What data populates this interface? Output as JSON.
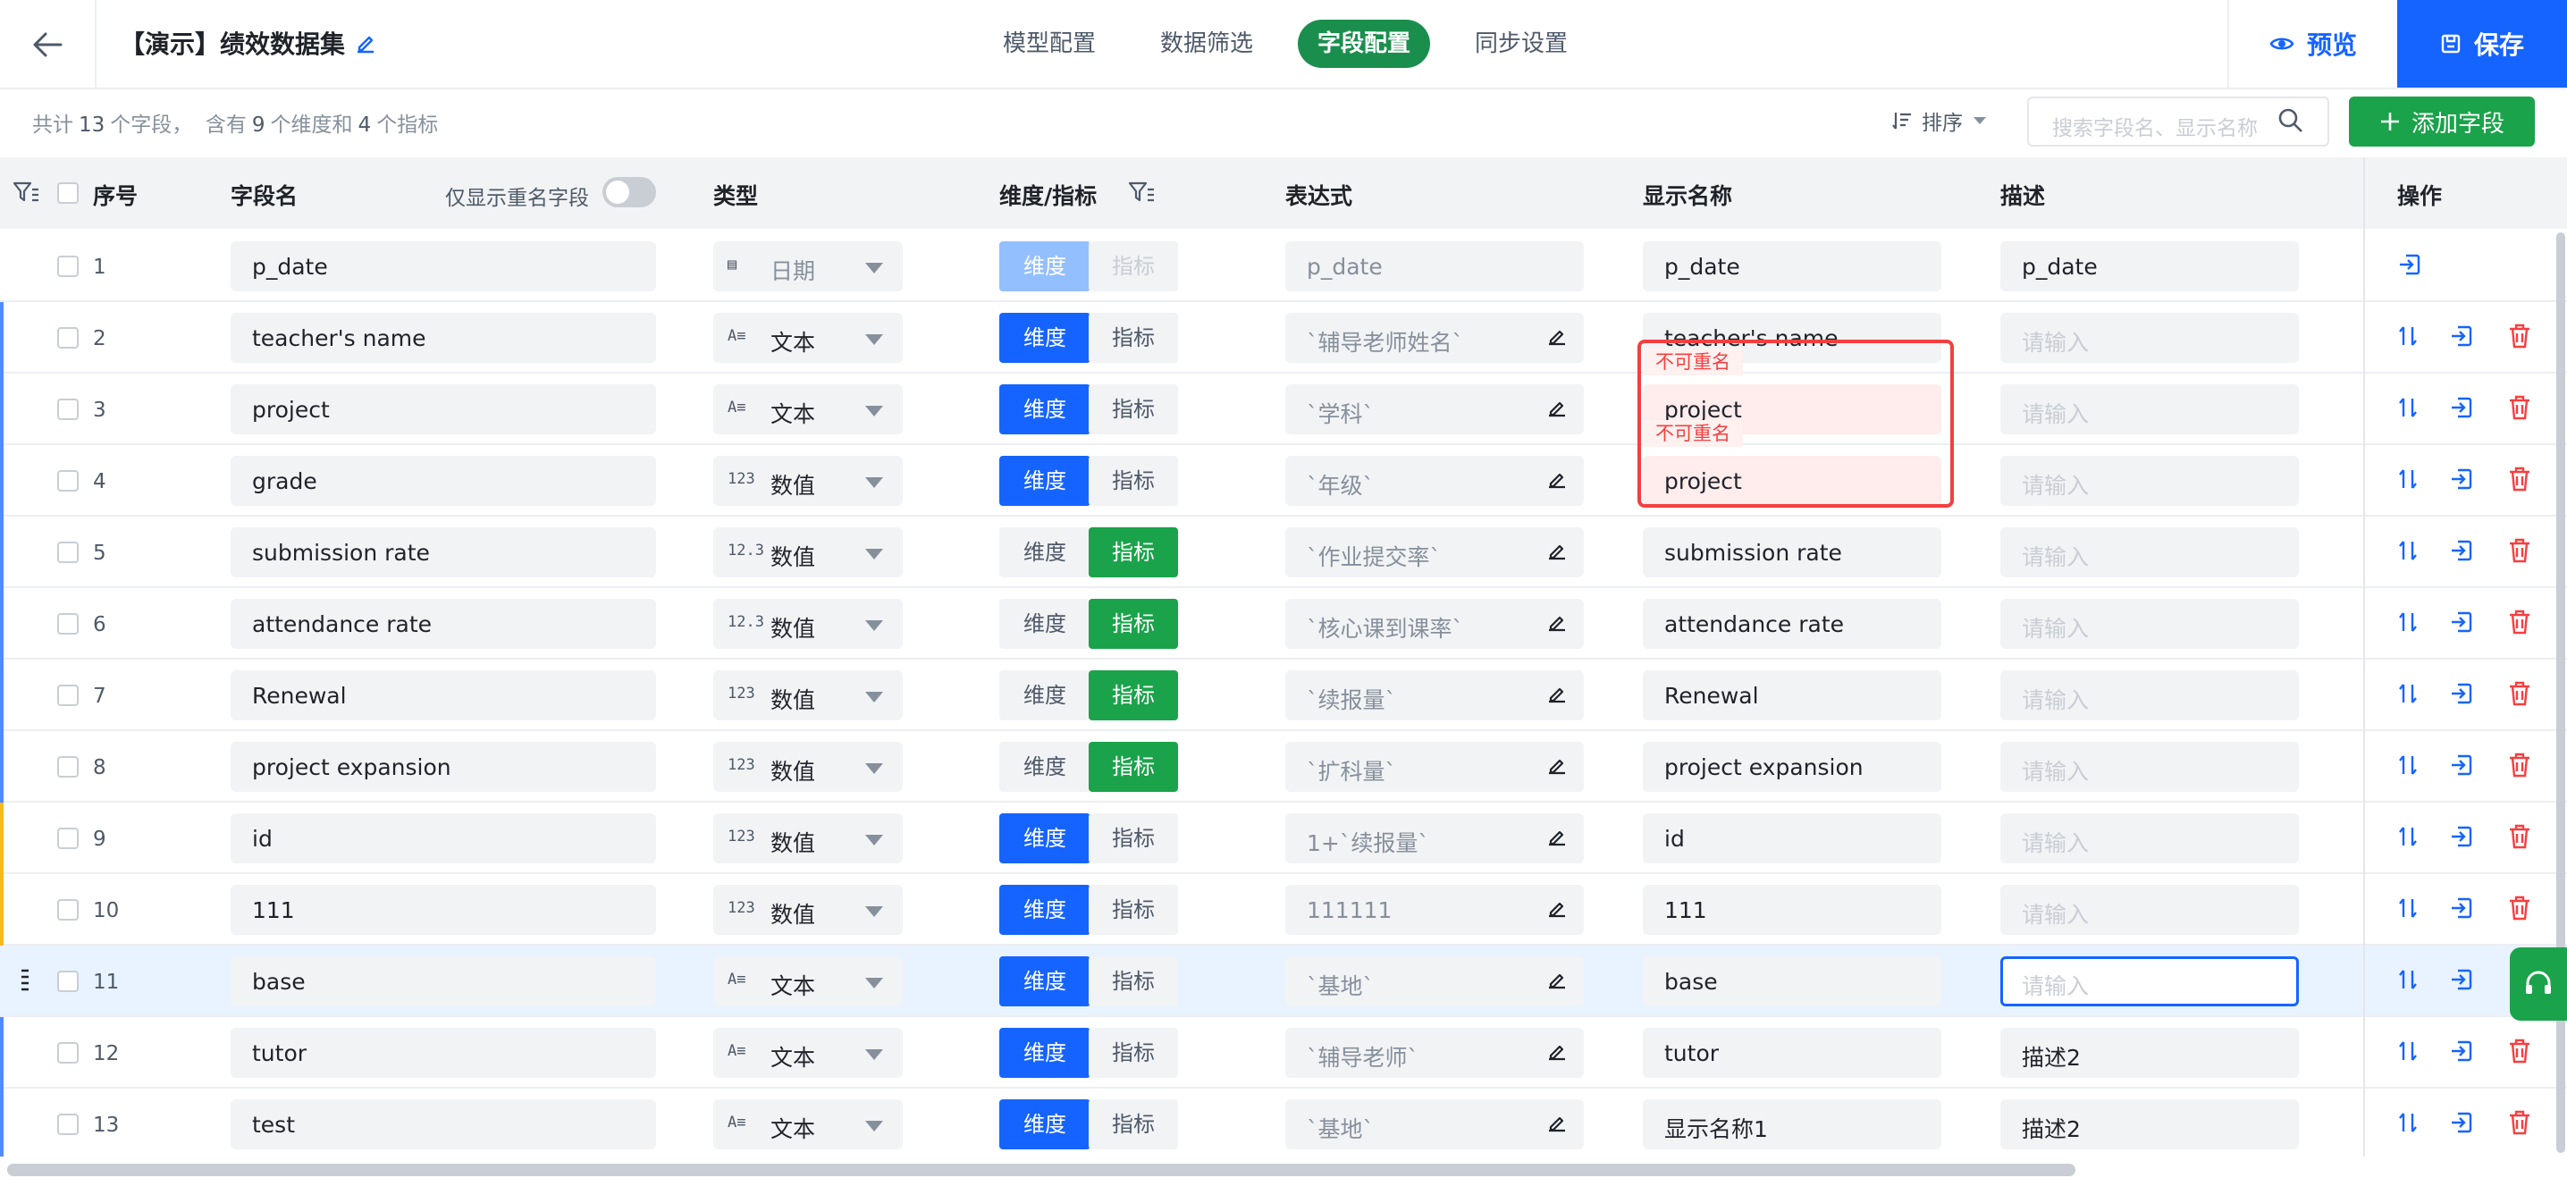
{
  "header": {
    "title": "【演示】绩效数据集",
    "tabs": [
      {
        "label": "模型配置",
        "active": false
      },
      {
        "label": "数据筛选",
        "active": false
      },
      {
        "label": "字段配置",
        "active": true
      },
      {
        "label": "同步设置",
        "active": false
      }
    ],
    "preview_label": "预览",
    "save_label": "保存"
  },
  "toolbar": {
    "summary_prefix": "共计",
    "total_fields": "13",
    "summary_mid1": "个字段，",
    "summary_mid2": "含有",
    "dimension_count": "9",
    "summary_mid3": "个维度和",
    "metric_count": "4",
    "summary_suffix": "个指标",
    "sort_label": "排序",
    "search_placeholder": "搜索字段名、显示名称",
    "add_field_label": "添加字段"
  },
  "columns": {
    "index": "序号",
    "field_name": "字段名",
    "only_duplicates": "仅显示重名字段",
    "type": "类型",
    "dim_metric": "维度/指标",
    "expression": "表达式",
    "display_name": "显示名称",
    "description": "描述",
    "actions": "操作"
  },
  "labels": {
    "dimension": "维度",
    "metric": "指标",
    "duplicate_error": "不可重名"
  },
  "colors": {
    "primary": "#1664ff",
    "green": "#1aa34a",
    "error": "#f53f3f",
    "blue_bar": "#4e8cff",
    "yellow_bar": "#f7ba1e"
  },
  "rows": [
    {
      "index": "1",
      "name": "p_date",
      "type_icon": "▤",
      "type": "日期",
      "role": "dimension",
      "expression": "p_date",
      "display": "p_date",
      "description": "p_date"
    },
    {
      "index": "2",
      "name": "teacher's name",
      "type_icon": "A≡",
      "type": "文本",
      "role": "dimension",
      "expression": "`辅导老师姓名`",
      "display": "teacher's name",
      "description": "请输入"
    },
    {
      "index": "3",
      "name": "project",
      "type_icon": "A≡",
      "type": "文本",
      "role": "dimension",
      "expression": "`学科`",
      "display": "project",
      "description": "请输入"
    },
    {
      "index": "4",
      "name": "grade",
      "type_icon": "123",
      "type": "数值",
      "role": "dimension",
      "expression": "`年级`",
      "display": "project",
      "description": "请输入"
    },
    {
      "index": "5",
      "name": "submission rate",
      "type_icon": "12.3",
      "type": "数值",
      "role": "metric",
      "expression": "`作业提交率`",
      "display": "submission rate",
      "description": "请输入"
    },
    {
      "index": "6",
      "name": "attendance rate",
      "type_icon": "12.3",
      "type": "数值",
      "role": "metric",
      "expression": "`核心课到课率`",
      "display": "attendance rate",
      "description": "请输入"
    },
    {
      "index": "7",
      "name": "Renewal",
      "type_icon": "123",
      "type": "数值",
      "role": "metric",
      "expression": "`续报量`",
      "display": "Renewal",
      "description": "请输入"
    },
    {
      "index": "8",
      "name": "project expansion",
      "type_icon": "123",
      "type": "数值",
      "role": "metric",
      "expression": "`扩科量`",
      "display": "project expansion",
      "description": "请输入"
    },
    {
      "index": "9",
      "name": "id",
      "type_icon": "123",
      "type": "数值",
      "role": "dimension",
      "expression": "1+`续报量`",
      "display": "id",
      "description": "请输入"
    },
    {
      "index": "10",
      "name": "111",
      "type_icon": "123",
      "type": "数值",
      "role": "dimension",
      "expression": "111111",
      "display": "111",
      "description": "请输入"
    },
    {
      "index": "11",
      "name": "base",
      "type_icon": "A≡",
      "type": "文本",
      "role": "dimension",
      "expression": "`基地`",
      "display": "base",
      "description": "请输入"
    },
    {
      "index": "12",
      "name": "tutor",
      "type_icon": "A≡",
      "type": "文本",
      "role": "dimension",
      "expression": "`辅导老师`",
      "display": "tutor",
      "description": "描述2"
    },
    {
      "index": "13",
      "name": "test",
      "type_icon": "A≡",
      "type": "文本",
      "role": "dimension",
      "expression": "`基地`",
      "display": "显示名称1",
      "description": "描述2"
    }
  ]
}
